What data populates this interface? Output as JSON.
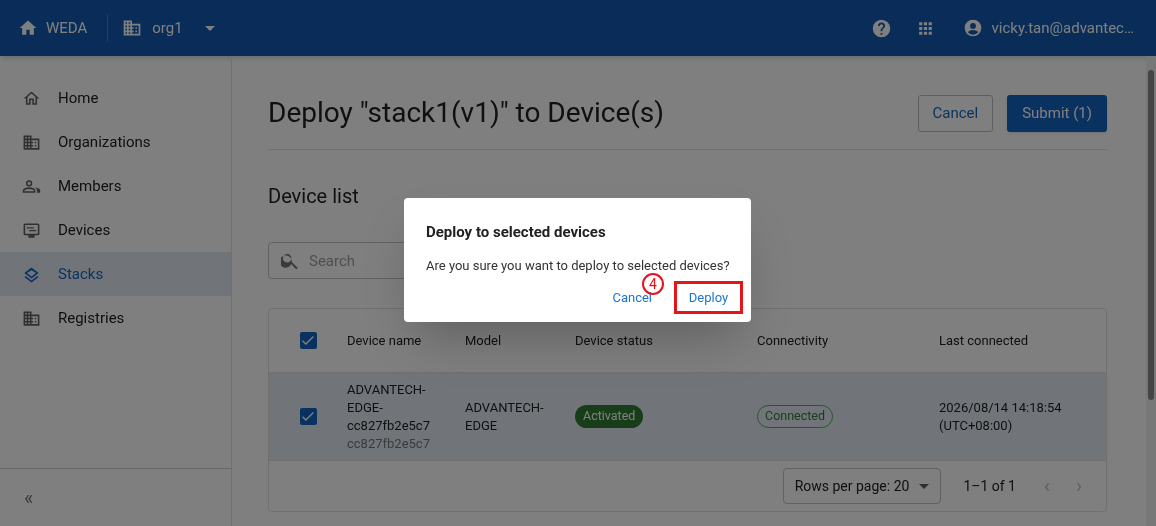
{
  "header": {
    "home": "WEDA",
    "org": "org1",
    "user": "vicky.tan@advantec…"
  },
  "sidebar": {
    "items": [
      {
        "label": "Home",
        "selected": false
      },
      {
        "label": "Organizations",
        "selected": false
      },
      {
        "label": "Members",
        "selected": false
      },
      {
        "label": "Devices",
        "selected": false
      },
      {
        "label": "Stacks",
        "selected": true
      },
      {
        "label": "Registries",
        "selected": false
      }
    ],
    "collapse": "«"
  },
  "page": {
    "title": "Deploy \"stack1(v1)\" to Device(s)",
    "cancel": "Cancel",
    "submit": "Submit (1)"
  },
  "device_list": {
    "title": "Device list",
    "search": {
      "placeholder": "Search"
    },
    "table": {
      "all_checked": true,
      "columns": [
        "Device name",
        "Model",
        "Device status",
        "Connectivity",
        "Last connected"
      ],
      "rows": [
        {
          "checked": true,
          "selected": true,
          "name": "ADVANTECH-EDGE-cc827fb2e5c7",
          "id": "cc827fb2e5c7",
          "model": "ADVANTECH-EDGE",
          "status": "Activated",
          "connectivity": "Connected",
          "last_connected": "2026/08/14 14:18:54 (UTC+08:00)"
        }
      ]
    },
    "pagination": {
      "rows_per_page": "Rows per page: 20",
      "range": "1–1 of 1",
      "prev": "‹",
      "next": "›"
    }
  },
  "dialog": {
    "title": "Deploy to selected devices",
    "message": "Are you sure you want to deploy to selected devices?",
    "cancel": "Cancel",
    "confirm": "Deploy",
    "step": "4"
  }
}
